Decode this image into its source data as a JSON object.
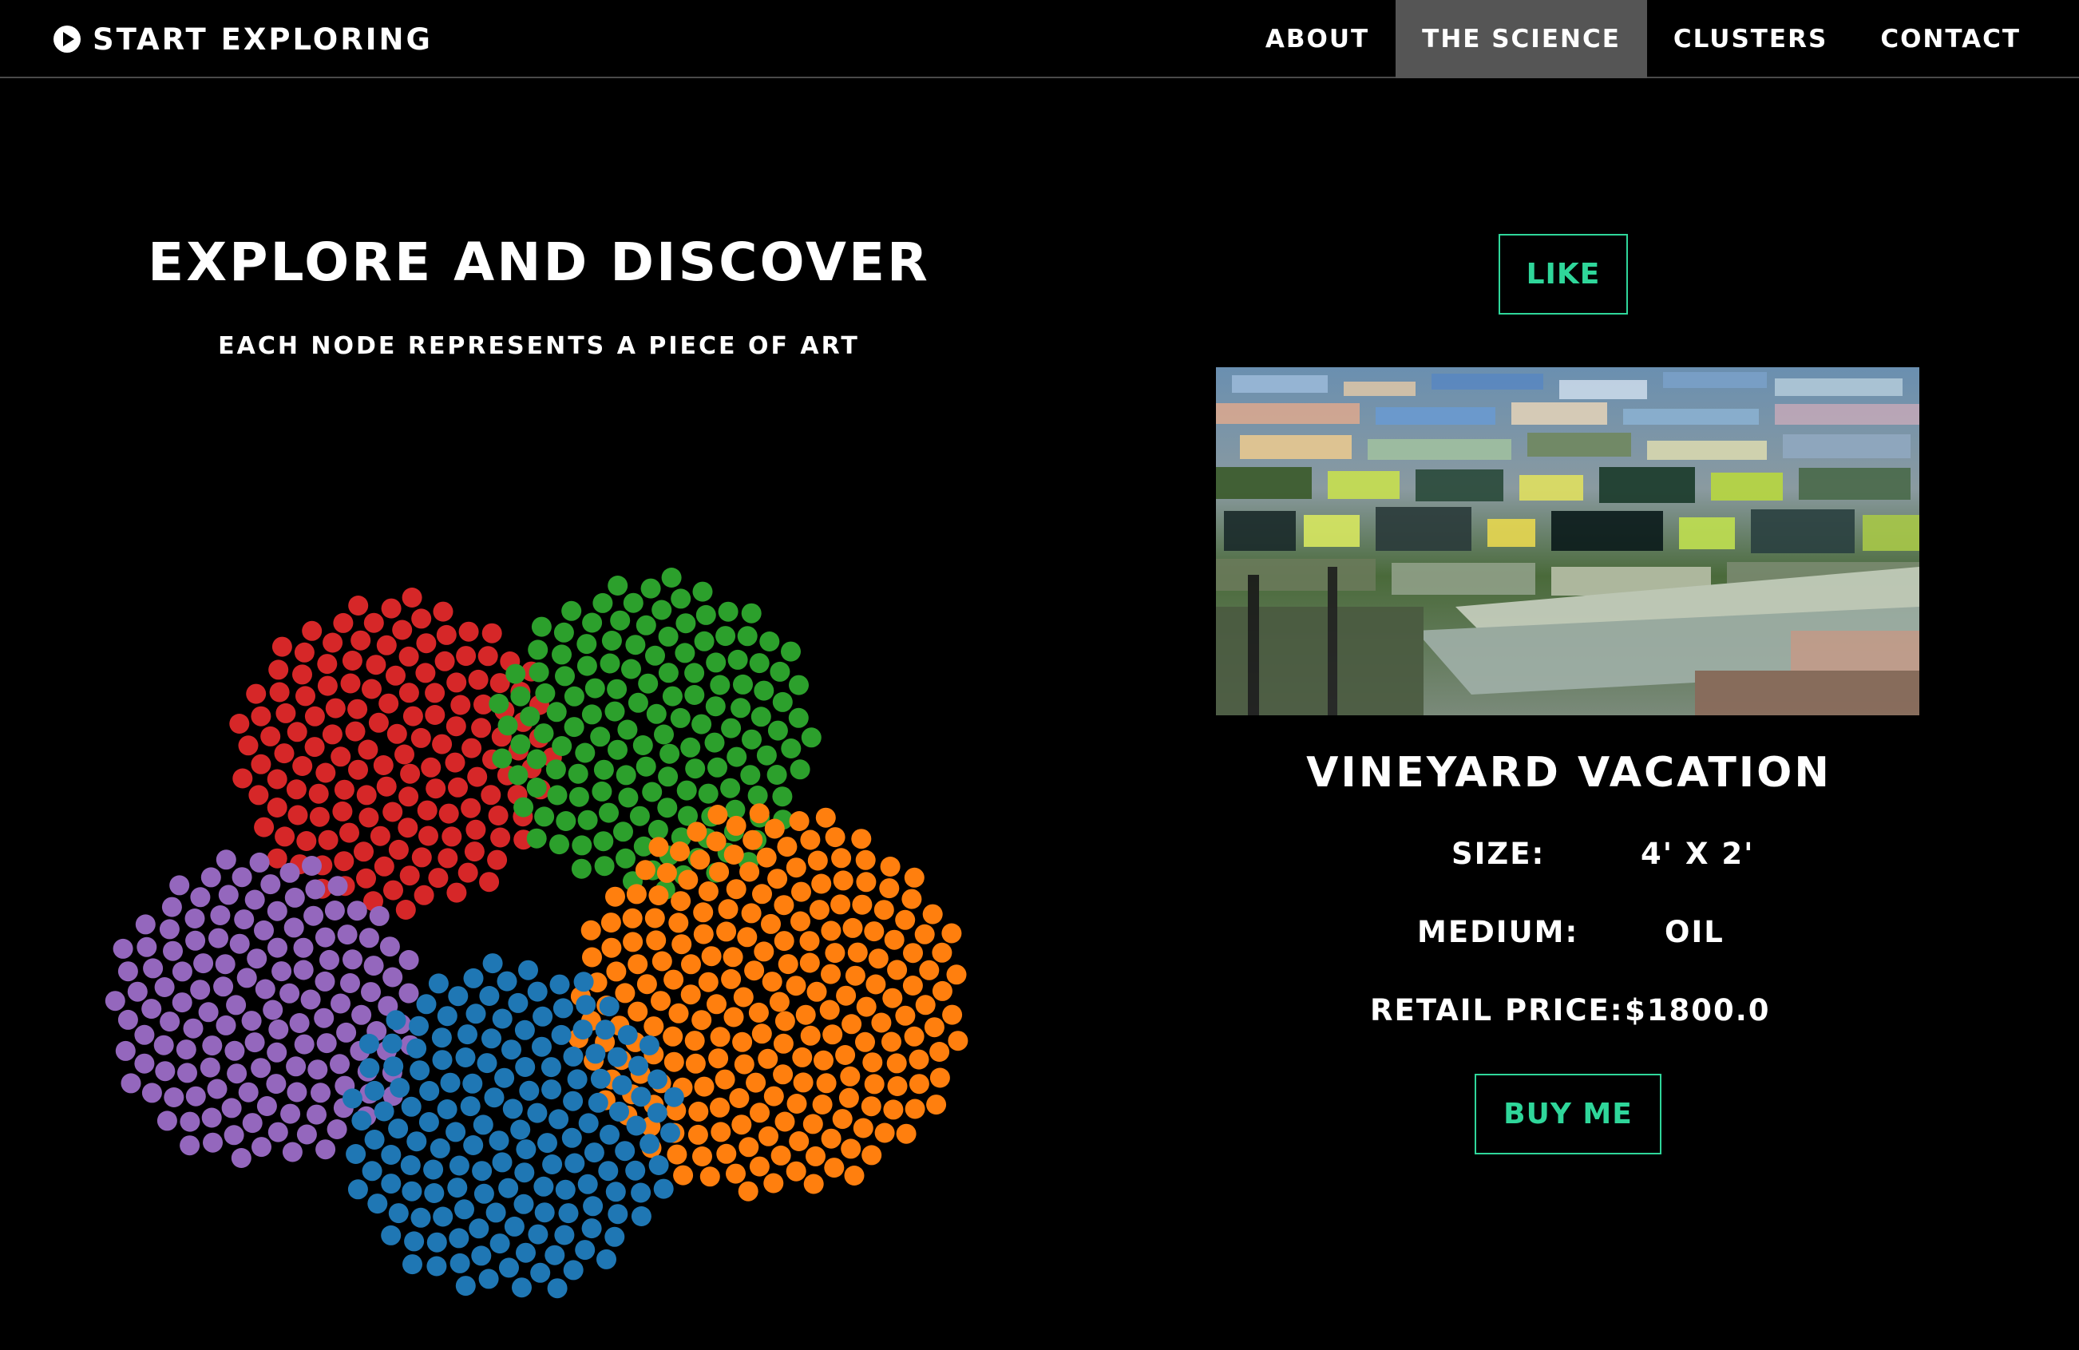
{
  "nav": {
    "brand": "START EXPLORING",
    "brand_icon": "play-circle-icon",
    "links": [
      "ABOUT",
      "THE SCIENCE",
      "CLUSTERS",
      "CONTACT"
    ],
    "active": "THE SCIENCE"
  },
  "left": {
    "title": "EXPLORE AND DISCOVER",
    "subtitle": "EACH NODE REPRESENTS A PIECE OF ART"
  },
  "clusters": {
    "colors": {
      "red": "#d62728",
      "green": "#2ca02c",
      "orange": "#ff7f0e",
      "purple": "#9467bd",
      "blue": "#1f77b4"
    }
  },
  "artwork": {
    "like_label": "LIKE",
    "title": "VINEYARD VACATION",
    "size_label": "SIZE:",
    "size_value": "4' X 2'",
    "medium_label": "MEDIUM:",
    "medium_value": "OIL",
    "price_label": "RETAIL PRICE:",
    "price_value": "$1800.0",
    "buy_label": "BUY ME"
  },
  "accent_color": "#2fd69a"
}
